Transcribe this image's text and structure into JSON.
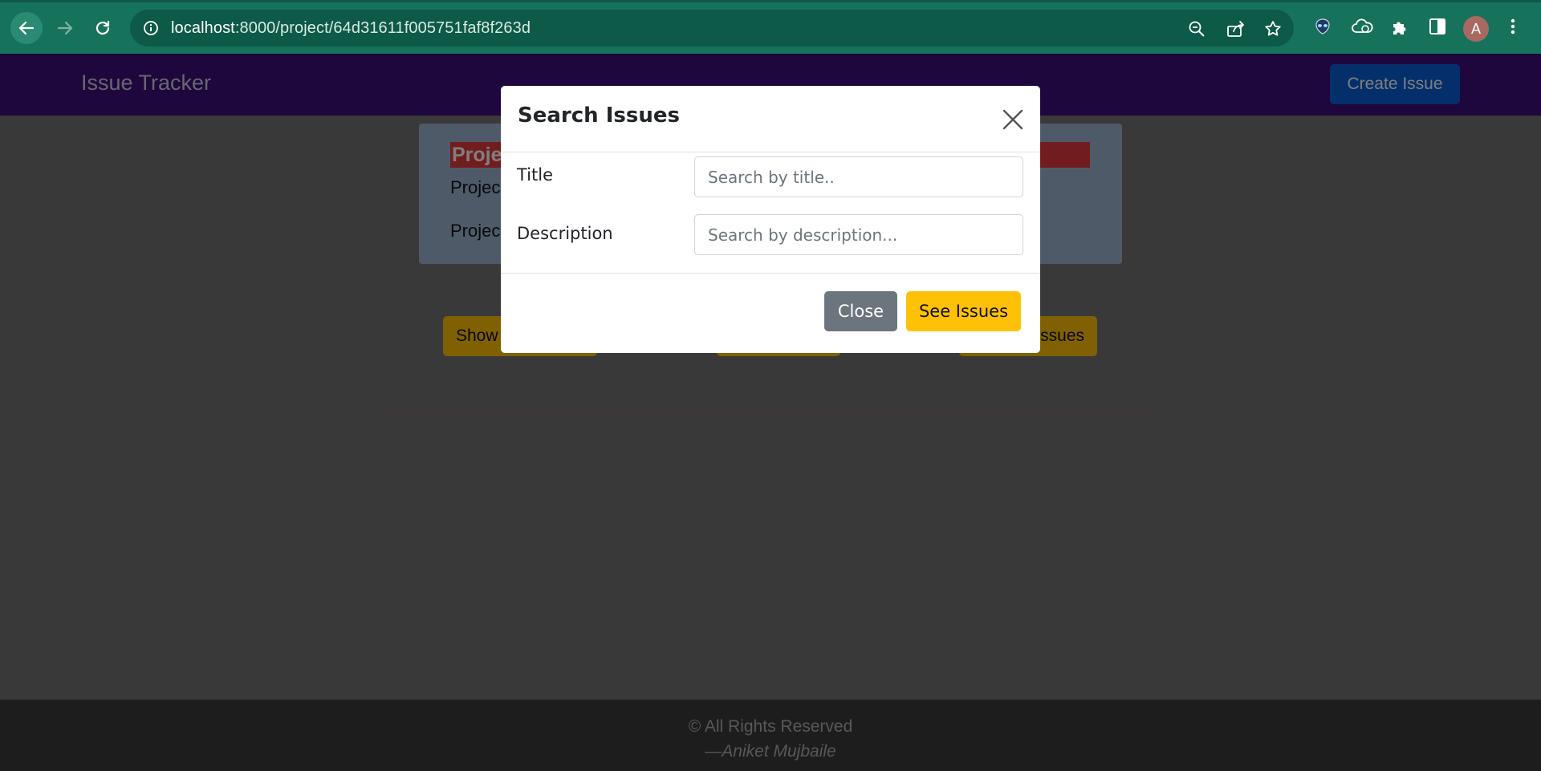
{
  "browser": {
    "url_host": "localhost",
    "url_path": ":8000/project/64d31611f005751faf8f263d",
    "avatar_letter": "A"
  },
  "navbar": {
    "brand": "Issue Tracker",
    "create_issue_label": "Create Issue"
  },
  "project_card": {
    "title_visible": "Proje",
    "line1_visible": "Projec",
    "line2_visible": "Projec"
  },
  "filters": {
    "left_button_visible": "Show",
    "right_button_visible": "ssues"
  },
  "modal": {
    "title": "Search Issues",
    "title_label": "Title",
    "title_placeholder": "Search by title..",
    "description_label": "Description",
    "description_placeholder": "Search by description...",
    "close_label": "Close",
    "submit_label": "See Issues"
  },
  "footer": {
    "rights": "© All Rights Reserved",
    "author": "—Aniket Mujbaile"
  },
  "colors": {
    "navbar": "#3b0f7a",
    "primary": "#0b5ed7",
    "warning": "#ffc107",
    "secondary": "#6c757d",
    "danger": "#e23a3a"
  }
}
